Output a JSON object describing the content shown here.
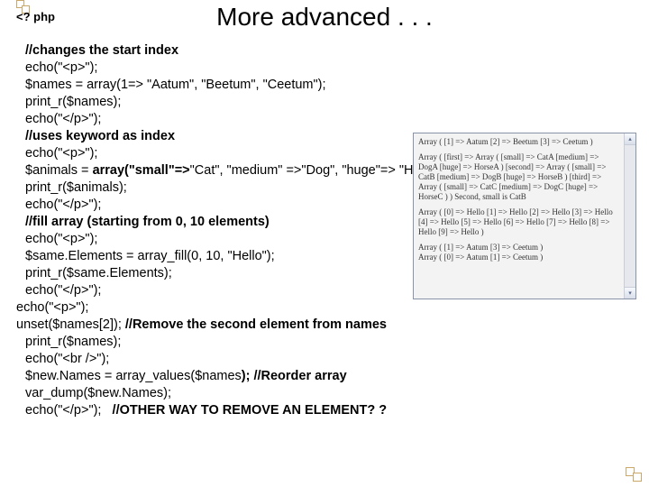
{
  "title": "More advanced . . .",
  "php_open": "<? php",
  "code": {
    "l1": "//changes the start index",
    "l2": "echo(\"<p>\");",
    "l3": "$names = array(1=> \"Aatum\", \"Beetum\", \"Ceetum\");",
    "l4": "print_r($names);",
    "l5": "echo(\"</p>\");",
    "l6": "//uses keyword as index",
    "l7": "echo(\"<p>\");",
    "l8a": "$animals = ",
    "l8b": "array(\"small\"=>",
    "l8c": "\"Cat\", \"medium\" =>\"Dog\", \"huge\"=> \"Horse\");",
    "l9": "print_r($animals);",
    "l10": "echo(\"</p>\");",
    "l11": "//fill array (starting from 0, 10 elements)",
    "l12": "echo(\"<p>\");",
    "l13": "$same.Elements = array_fill(0, 10, \"Hello\");",
    "l14": "print_r($same.Elements);",
    "l15": "echo(\"</p>\");",
    "l16": "echo(\"<p>\");",
    "l17a": "unset($names[2]); ",
    "l17b": "//Remove the second element from names",
    "l18": "print_r($names);",
    "l19": "echo(\"<br />\");",
    "l20a": "$new.Names = array_values($names",
    "l20b": "); //Reorder array",
    "l21": "var_dump($new.Names);",
    "l22a": "echo(\"</p>\");   ",
    "l22b": "//OTHER WAY TO REMOVE AN ELEMENT? ?"
  },
  "output": {
    "p1": "Array ( [1] => Aatum [2] => Beetum [3] => Ceetum )",
    "p2": "Array ( [first] => Array ( [small] => CatA [medium] => DogA [huge] => HorseA ) [second] => Array ( [small] => CatB [medium] => DogB [huge] => HorseB ) [third] => Array ( [small] => CatC [medium] => DogC [huge] => HorseC ) ) Second, small is CatB",
    "p3": "Array ( [0] => Hello [1] => Hello [2] => Hello [3] => Hello [4] => Hello [5] => Hello [6] => Hello [7] => Hello [8] => Hello [9] => Hello )",
    "p4a": "Array ( [1] => Aatum [3] => Ceetum )",
    "p4b": "Array ( [0] => Aatum [1] => Ceetum )"
  }
}
